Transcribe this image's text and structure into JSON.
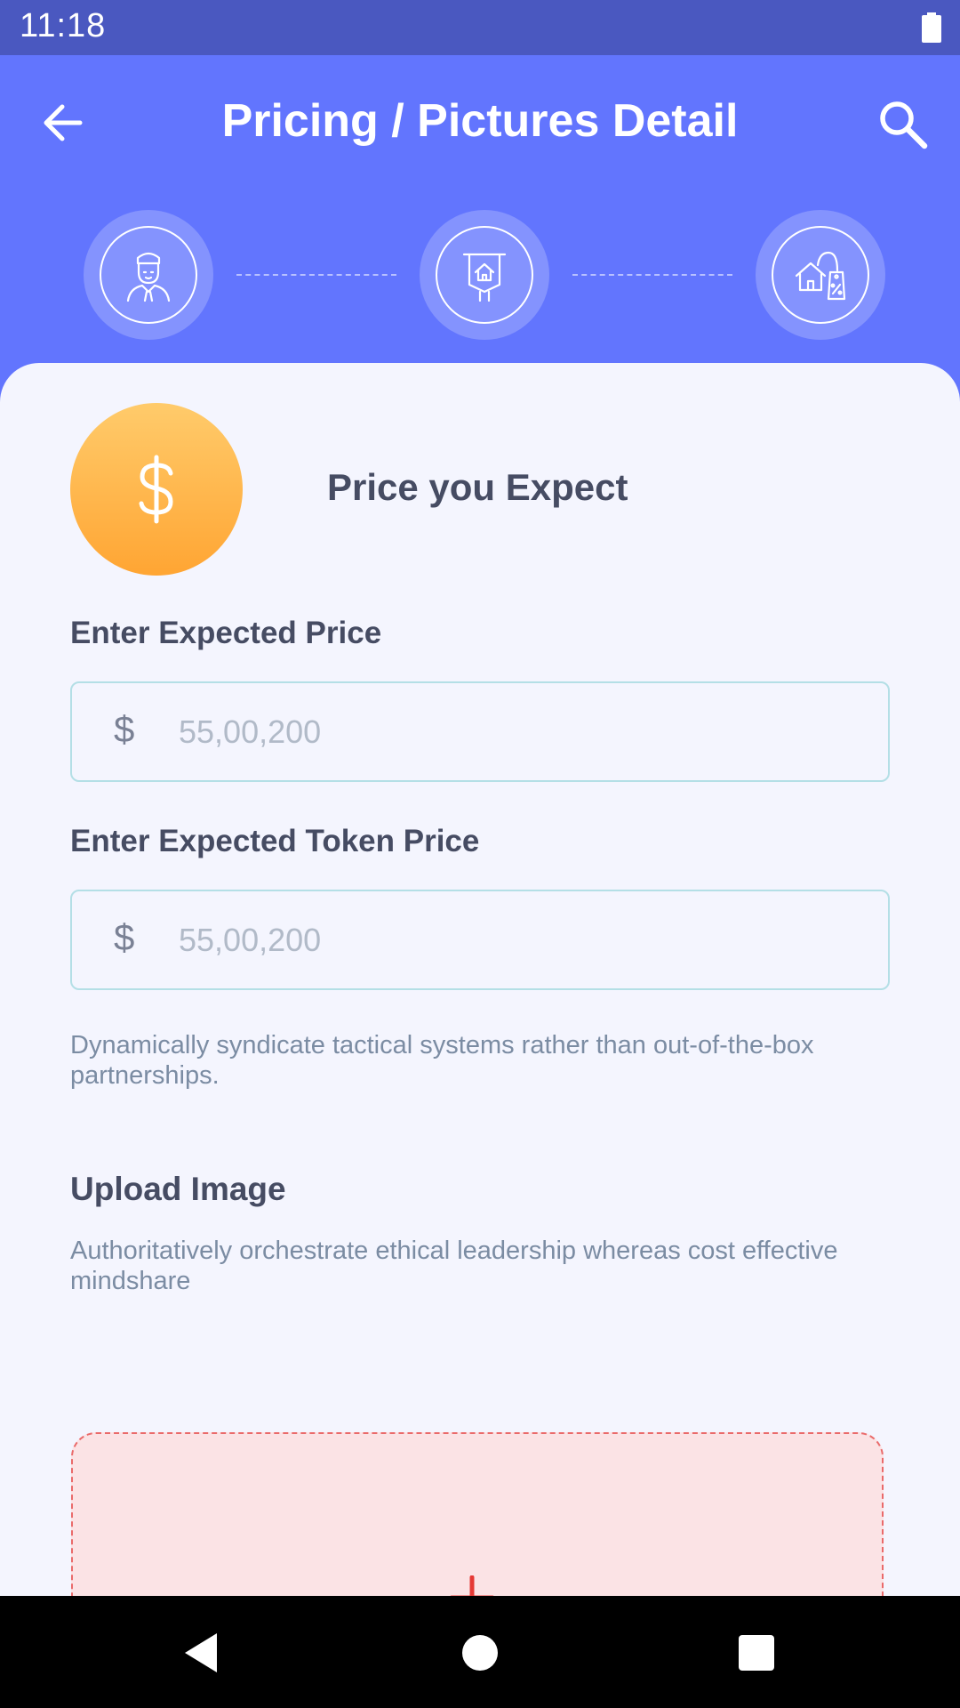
{
  "status_bar": {
    "time": "11:18",
    "icons": [
      "battery-icon"
    ]
  },
  "header": {
    "title": "Pricing / Pictures Detail",
    "back_icon": "arrow-left-icon",
    "search_icon": "search-icon",
    "background_color": "#6275fe"
  },
  "steps": [
    {
      "icon": "person-icon"
    },
    {
      "icon": "house-banner-icon"
    },
    {
      "icon": "house-tag-icon"
    }
  ],
  "price_section": {
    "icon": "dollar-icon",
    "title": "Price you Expect",
    "accent_color": "#ffb347"
  },
  "fields": {
    "expected_price": {
      "label": "Enter Expected Price",
      "currency_symbol": "$",
      "placeholder": "55,00,200",
      "value": ""
    },
    "token_price": {
      "label": "Enter Expected Token Price",
      "currency_symbol": "$",
      "placeholder": "55,00,200",
      "value": ""
    }
  },
  "helper_text": "Dynamically syndicate tactical systems rather than out-of-the-box partnerships.",
  "upload": {
    "title": "Upload Image",
    "description": "Authoritatively orchestrate ethical leadership whereas cost effective mindshare",
    "icon": "plus-icon",
    "accent_color": "#e53935"
  },
  "nav_bar": {
    "icons": [
      "nav-back-icon",
      "nav-home-icon",
      "nav-recent-icon"
    ]
  }
}
